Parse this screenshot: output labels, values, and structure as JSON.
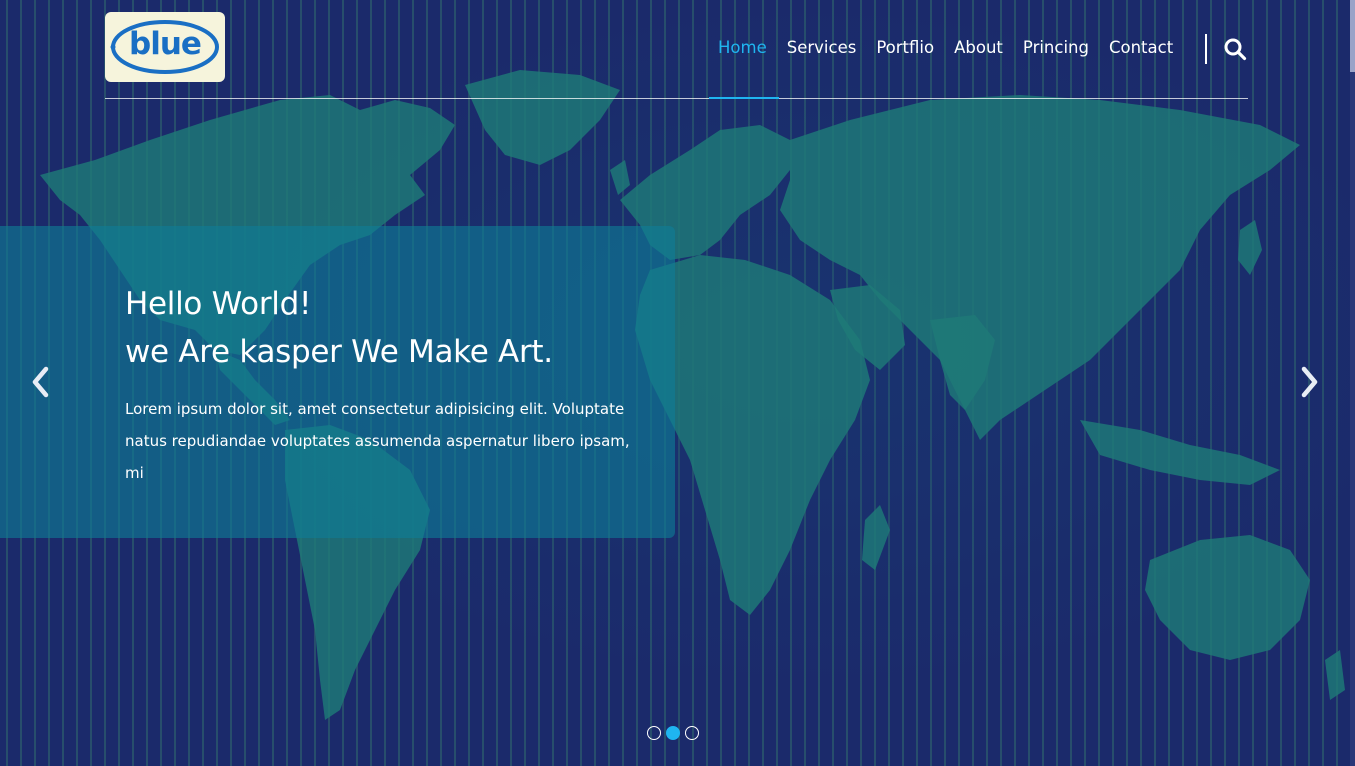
{
  "brand": {
    "logo_text": "blue",
    "logo_color": "#1a6fc4",
    "logo_background": "#f6f4dc"
  },
  "nav": {
    "items": [
      {
        "label": "Home",
        "active": true
      },
      {
        "label": "Services",
        "active": false
      },
      {
        "label": "Portflio",
        "active": false
      },
      {
        "label": "About",
        "active": false
      },
      {
        "label": "Princing",
        "active": false
      },
      {
        "label": "Contact",
        "active": false
      }
    ],
    "search_icon": "search-icon",
    "accent_color": "#1fb5f0"
  },
  "slider": {
    "title_line1": "Hello World!",
    "title_line2": "we Are kasper We Make Art.",
    "text": "Lorem ipsum dolor sit, amet consectetur adipisicing elit. Voluptate natus repudiandae voluptates assumenda aspernatur libero ipsam, mi",
    "prev_icon": "chevron-left-icon",
    "next_icon": "chevron-right-icon",
    "slide_count": 3,
    "active_slide": 2
  },
  "colors": {
    "background": "#1b2a6b",
    "map_land": "#1e7a78",
    "panel": "#0f7d96"
  }
}
